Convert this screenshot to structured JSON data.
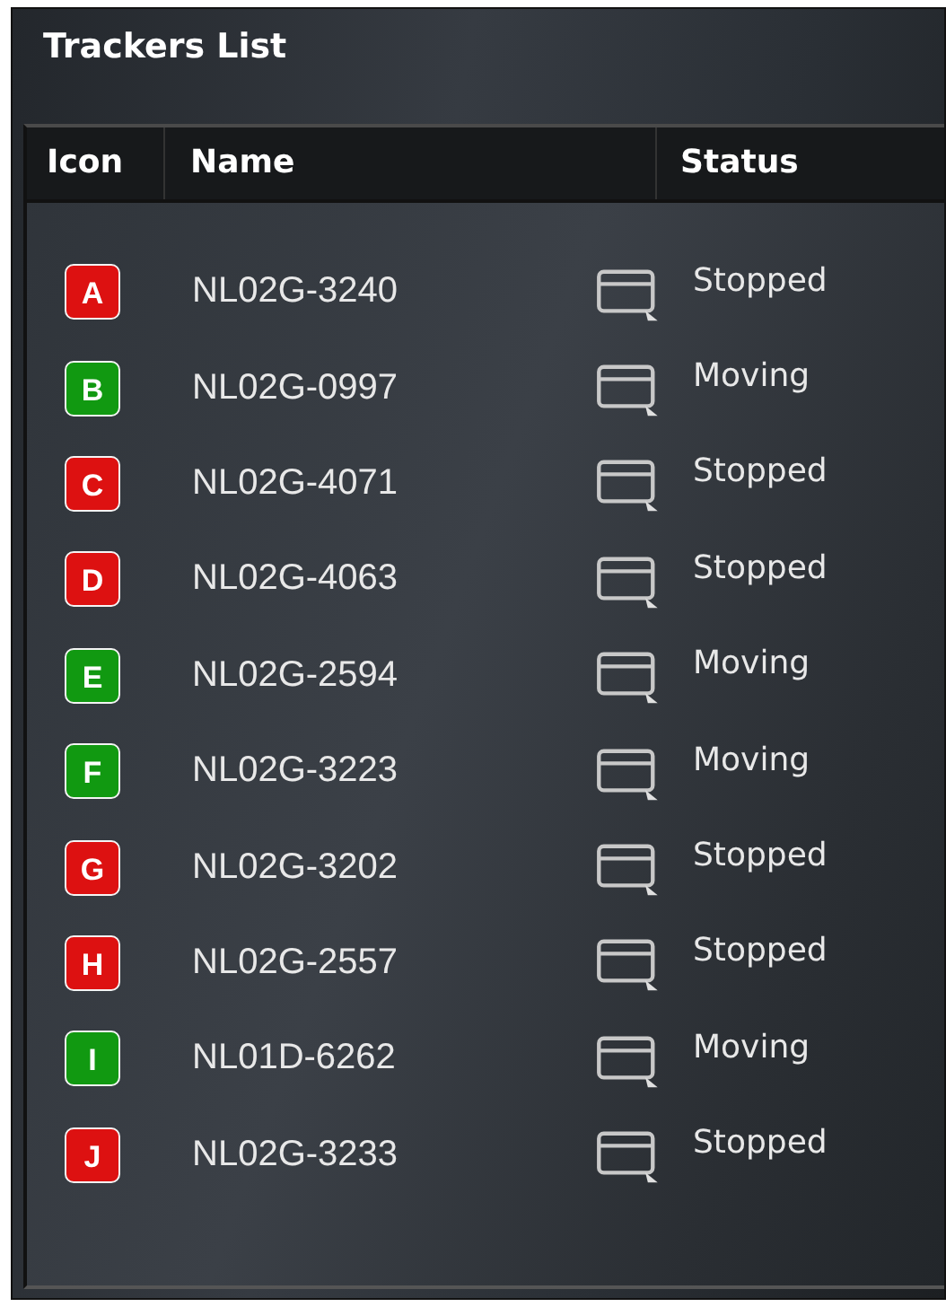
{
  "panel": {
    "title": "Trackers List"
  },
  "table": {
    "columns": [
      "Icon",
      "Name",
      "Status"
    ],
    "rows": [
      {
        "icon": "A",
        "color": "#dd1111",
        "name": "NL02G-3240",
        "status": "Stopped"
      },
      {
        "icon": "B",
        "color": "#119911",
        "name": "NL02G-0997",
        "status": "Moving"
      },
      {
        "icon": "C",
        "color": "#dd1111",
        "name": "NL02G-4071",
        "status": "Stopped"
      },
      {
        "icon": "D",
        "color": "#dd1111",
        "name": "NL02G-4063",
        "status": "Stopped"
      },
      {
        "icon": "E",
        "color": "#119911",
        "name": "NL02G-2594",
        "status": "Moving"
      },
      {
        "icon": "F",
        "color": "#119911",
        "name": "NL02G-3223",
        "status": "Moving"
      },
      {
        "icon": "G",
        "color": "#dd1111",
        "name": "NL02G-3202",
        "status": "Stopped"
      },
      {
        "icon": "H",
        "color": "#dd1111",
        "name": "NL02G-2557",
        "status": "Stopped"
      },
      {
        "icon": "I",
        "color": "#119911",
        "name": "NL01D-6262",
        "status": "Moving"
      },
      {
        "icon": "J",
        "color": "#dd1111",
        "name": "NL02G-3233",
        "status": "Stopped"
      }
    ]
  }
}
